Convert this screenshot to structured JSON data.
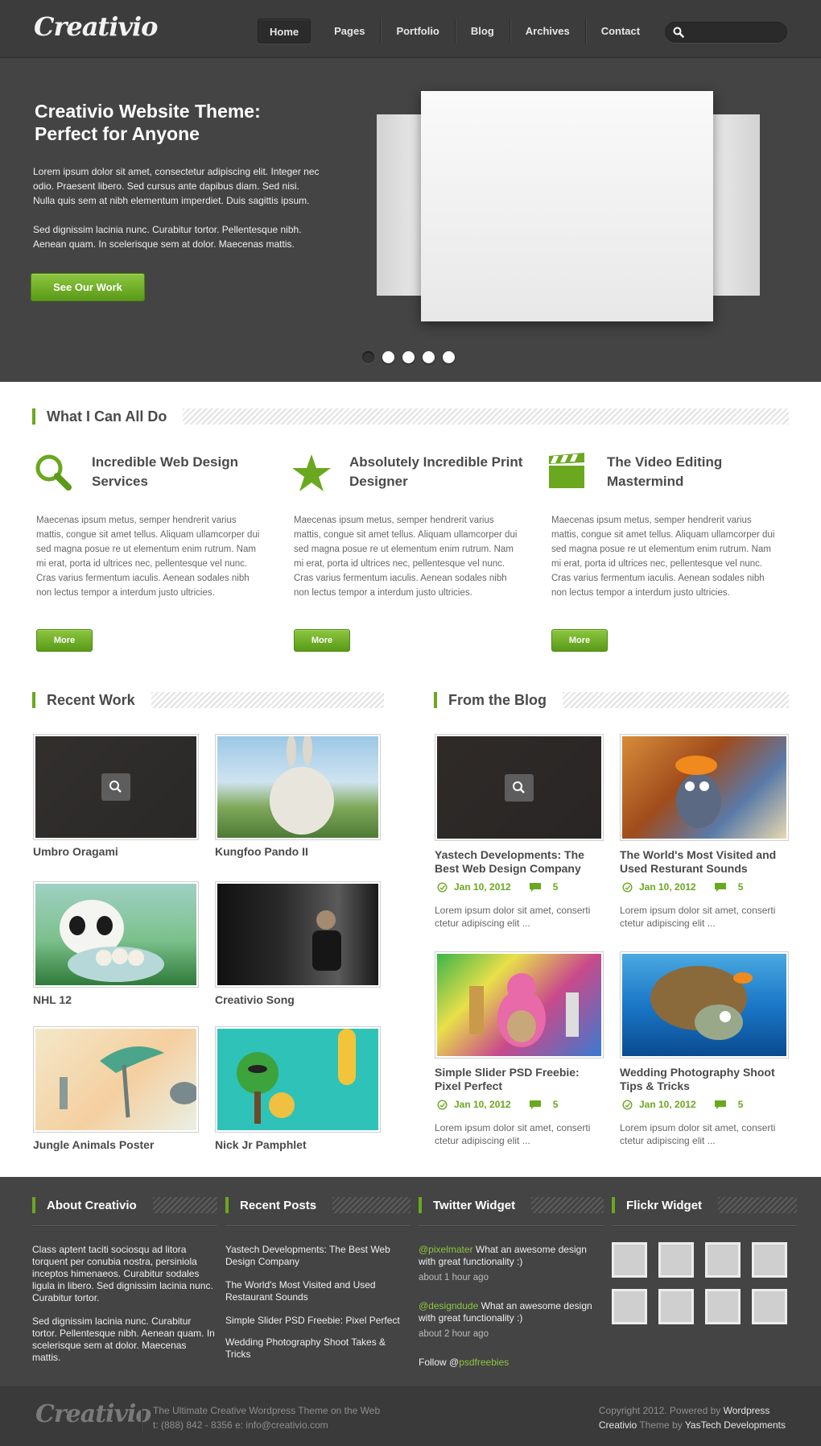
{
  "header": {
    "logo": "Creativio",
    "nav": [
      "Home",
      "Pages",
      "Portfolio",
      "Blog",
      "Archives",
      "Contact"
    ],
    "search_placeholder": ""
  },
  "hero": {
    "title": "Creativio Website Theme: Perfect for Anyone",
    "p1": "Lorem ipsum dolor sit amet, consectetur adipiscing elit. Integer nec odio. Praesent libero. Sed cursus ante dapibus diam. Sed nisi. Nulla quis sem at nibh elementum imperdiet. Duis sagittis ipsum.",
    "p2": "Sed dignissim lacinia nunc. Curabitur tortor. Pellentesque nibh. Aenean quam. In scelerisque sem at dolor. Maecenas mattis.",
    "button": "See Our Work",
    "active_slide": 1,
    "slide_count": 5
  },
  "services": {
    "title": "What I Can All Do",
    "items": [
      {
        "icon": "magnifier-icon",
        "title": "Incredible Web Design Services",
        "text": "Maecenas ipsum metus, semper hendrerit varius mattis, congue sit amet tellus. Aliquam ullamcorper dui sed magna posue re ut elementum enim rutrum. Nam mi erat, porta id ultrices nec, pellentesque vel nunc. Cras varius fermentum iaculis. Aenean sodales nibh non lectus tempor a interdum justo ultricies.",
        "button": "More"
      },
      {
        "icon": "star-icon",
        "title": "Absolutely Incredible Print Designer",
        "text": "Maecenas ipsum metus, semper hendrerit varius mattis, congue sit amet tellus. Aliquam ullamcorper dui sed magna posue re ut elementum enim rutrum. Nam mi erat, porta id ultrices nec, pellentesque vel nunc. Cras varius fermentum iaculis. Aenean sodales nibh non lectus tempor a interdum justo ultricies.",
        "button": "More"
      },
      {
        "icon": "clapperboard-icon",
        "title": "The Video Editing Mastermind",
        "text": "Maecenas ipsum metus, semper hendrerit varius mattis, congue sit amet tellus. Aliquam ullamcorper dui sed magna posue re ut elementum enim rutrum. Nam mi erat, porta id ultrices nec, pellentesque vel nunc. Cras varius fermentum iaculis. Aenean sodales nibh non lectus tempor a interdum justo ultricies.",
        "button": "More"
      }
    ]
  },
  "work": {
    "title": "Recent Work",
    "items": [
      "Umbro Oragami",
      "Kungfoo Pando II",
      "NHL 12",
      "Creativio Song",
      "Jungle Animals Poster",
      "Nick Jr Pamphlet"
    ]
  },
  "blog": {
    "title": "From the Blog",
    "posts": [
      {
        "title": "Yastech Developments: The Best Web Design Company",
        "date": "Jan 10, 2012",
        "comments": "5",
        "excerpt": "Lorem ipsum dolor sit amet, conserti ctetur adipiscing elit ..."
      },
      {
        "title": "The World's Most Visited and Used Resturant Sounds",
        "date": "Jan 10, 2012",
        "comments": "5",
        "excerpt": "Lorem ipsum dolor sit amet, conserti ctetur adipiscing elit ..."
      },
      {
        "title": "Simple Slider PSD Freebie: Pixel Perfect",
        "date": "Jan 10, 2012",
        "comments": "5",
        "excerpt": "Lorem ipsum dolor sit amet, conserti ctetur adipiscing elit ..."
      },
      {
        "title": "Wedding Photography Shoot Tips & Tricks",
        "date": "Jan 10, 2012",
        "comments": "5",
        "excerpt": "Lorem ipsum dolor sit amet, conserti ctetur adipiscing elit ..."
      }
    ]
  },
  "widgets": {
    "about": {
      "title": "About Creativio",
      "p1": "Class aptent taciti sociosqu ad litora torquent per conubia nostra, persiniola inceptos himenaeos. Curabitur sodales ligula in libero. Sed dignissim lacinia nunc. Curabitur tortor.",
      "p2": "Sed dignissim lacinia nunc. Curabitur tortor. Pellentesque nibh. Aenean quam. In scelerisque sem at dolor. Maecenas mattis."
    },
    "recent_posts": {
      "title": "Recent Posts",
      "items": [
        "Yastech Developments: The Best Web Design Company",
        "The World's Most Visited and Used Restaurant Sounds",
        "Simple Slider PSD Freebie: Pixel Perfect",
        "Wedding Photography Shoot Takes & Tricks"
      ]
    },
    "twitter": {
      "title": "Twitter Widget",
      "tweets": [
        {
          "handle": "@pixelmater",
          "text": " What an awesome design with great functionality :)",
          "time": "about 1 hour ago"
        },
        {
          "handle": "@designdude",
          "text": " What an awesome design with great functionality :)",
          "time": "about 2 hour ago"
        }
      ],
      "follow_label": "Follow @",
      "follow_handle": "psdfreebies"
    },
    "flickr": {
      "title": "Flickr Widget"
    }
  },
  "footer": {
    "logo": "Creativio",
    "line1": "The Ultimate Creative Wordpress Theme on the Web",
    "line2": "t: (888) 842 - 8356  e: info@creativio.com",
    "copyright": "Copyright 2012. Powered by ",
    "powered": "Wordpress",
    "theme_name": "Creativio",
    "theme_by": " Theme by ",
    "developer": "YasTech Developments"
  },
  "colors": {
    "accent": "#6aa81f",
    "dark_bg": "#444444"
  }
}
